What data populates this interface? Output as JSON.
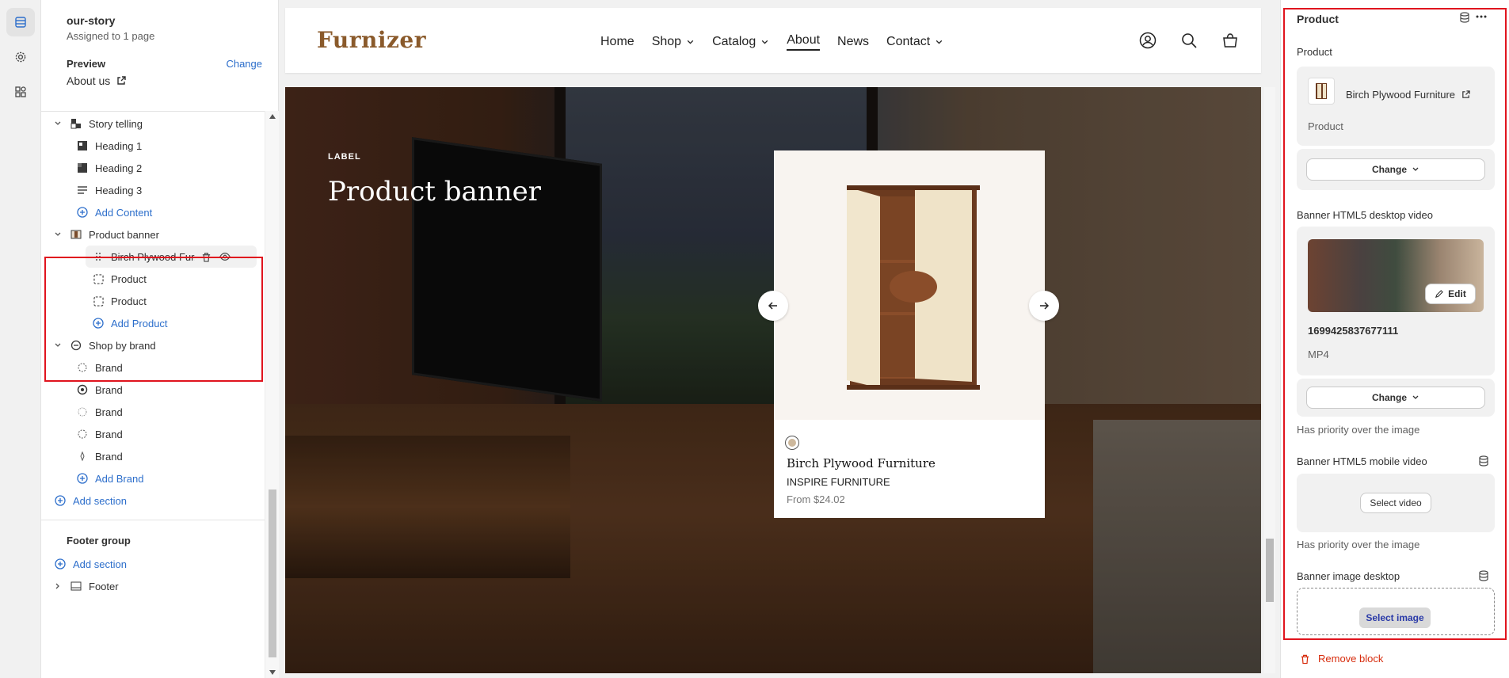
{
  "template": {
    "name": "our-story",
    "assignment": "Assigned to 1 page",
    "preview_label": "Preview",
    "change_label": "Change",
    "preview_page": "About us"
  },
  "tree": {
    "story_telling": "Story telling",
    "heading1": "Heading 1",
    "heading2": "Heading 2",
    "heading3": "Heading 3",
    "add_content": "Add Content",
    "product_banner": "Product banner",
    "birch_item": "Birch Plywood Fur...",
    "product1": "Product",
    "product2": "Product",
    "add_product": "Add Product",
    "shop_by_brand": "Shop by brand",
    "brands": [
      "Brand",
      "Brand",
      "Brand",
      "Brand",
      "Brand"
    ],
    "add_brand": "Add Brand",
    "add_section": "Add section",
    "footer_group": "Footer group",
    "add_section_footer": "Add section",
    "footer": "Footer"
  },
  "store": {
    "logo": "Furnizer",
    "nav": [
      "Home",
      "Shop",
      "Catalog",
      "About",
      "News",
      "Contact"
    ],
    "active_nav": "About"
  },
  "banner": {
    "label": "LABEL",
    "title": "Product banner",
    "product_title": "Birch Plywood Furniture",
    "product_brand": "INSPIRE FURNITURE",
    "product_price": "From $24.02",
    "slides": 3,
    "active_slide": 1
  },
  "right": {
    "title": "Product",
    "product_label": "Product",
    "product_name": "Birch Plywood Furniture",
    "product_type": "Product",
    "change": "Change",
    "desktop_video_label": "Banner HTML5 desktop video",
    "edit": "Edit",
    "video_name": "1699425837677111",
    "video_type": "MP4",
    "change2": "Change",
    "priority_note1": "Has priority over the image",
    "mobile_video_label": "Banner HTML5 mobile video",
    "select_video": "Select video",
    "priority_note2": "Has priority over the image",
    "image_desktop_label": "Banner image desktop",
    "select_image": "Select image",
    "remove_block": "Remove block"
  },
  "colors": {
    "accent": "#2c6ecb",
    "highlight": "#e0141e",
    "logo": "#8a5a2b",
    "danger": "#d72c0d"
  }
}
